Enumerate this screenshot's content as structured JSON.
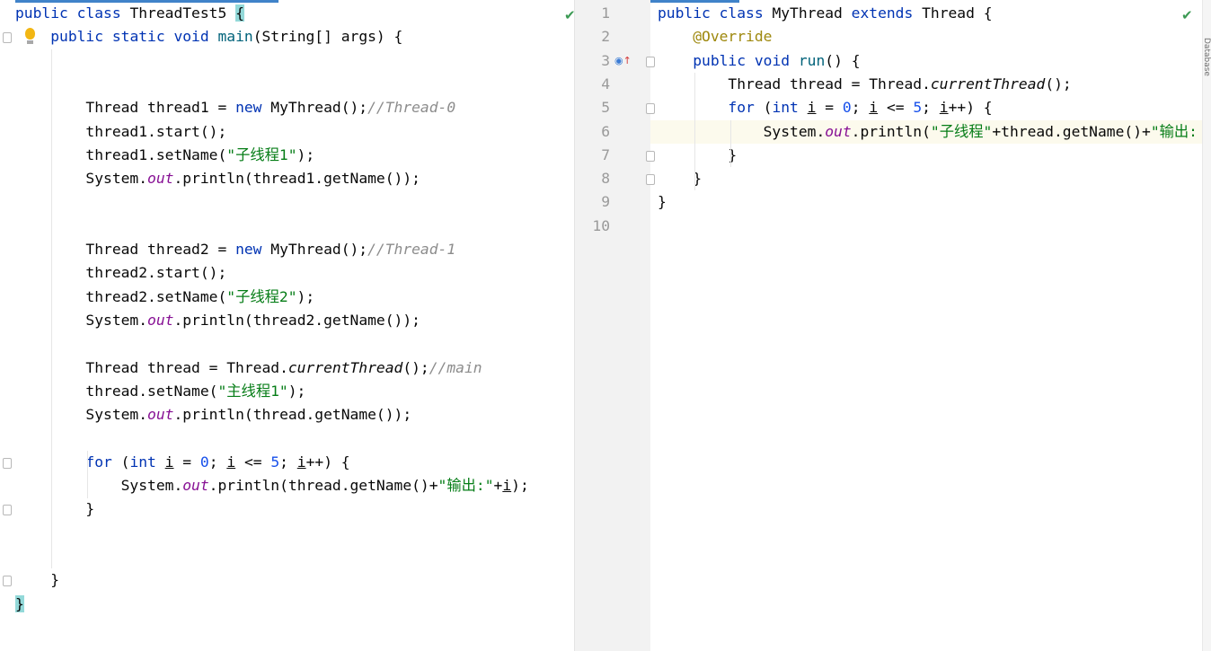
{
  "left_editor": {
    "file": "ThreadTest5",
    "lines": [
      {
        "parts": [
          {
            "t": "public class ",
            "c": "kw"
          },
          {
            "t": "ThreadTest5 "
          },
          {
            "t": "{",
            "c": "brace-hl"
          }
        ]
      },
      {
        "parts": [
          {
            "t": "    "
          },
          {
            "t": "public static void ",
            "c": "kw"
          },
          {
            "t": "main",
            "c": "fn"
          },
          {
            "t": "(String[] args) {"
          }
        ]
      },
      {
        "parts": []
      },
      {
        "parts": []
      },
      {
        "parts": [
          {
            "t": "        Thread thread1 = "
          },
          {
            "t": "new ",
            "c": "kw"
          },
          {
            "t": "MyThread();"
          },
          {
            "t": "//Thread-0",
            "c": "cm"
          }
        ]
      },
      {
        "parts": [
          {
            "t": "        thread1.start();"
          }
        ]
      },
      {
        "parts": [
          {
            "t": "        thread1.setName("
          },
          {
            "t": "\"子线程1\"",
            "c": "str"
          },
          {
            "t": ");"
          }
        ]
      },
      {
        "parts": [
          {
            "t": "        System."
          },
          {
            "t": "out",
            "c": "fld"
          },
          {
            "t": ".println(thread1.getName());"
          }
        ]
      },
      {
        "parts": []
      },
      {
        "parts": []
      },
      {
        "parts": [
          {
            "t": "        Thread thread2 = "
          },
          {
            "t": "new ",
            "c": "kw"
          },
          {
            "t": "MyThread();"
          },
          {
            "t": "//Thread-1",
            "c": "cm"
          }
        ]
      },
      {
        "parts": [
          {
            "t": "        thread2.start();"
          }
        ]
      },
      {
        "parts": [
          {
            "t": "        thread2.setName("
          },
          {
            "t": "\"子线程2\"",
            "c": "str"
          },
          {
            "t": ");"
          }
        ]
      },
      {
        "parts": [
          {
            "t": "        System."
          },
          {
            "t": "out",
            "c": "fld"
          },
          {
            "t": ".println(thread2.getName());"
          }
        ]
      },
      {
        "parts": []
      },
      {
        "parts": [
          {
            "t": "        Thread thread = Thread."
          },
          {
            "t": "currentThread",
            "c": "st"
          },
          {
            "t": "();"
          },
          {
            "t": "//main",
            "c": "cm"
          }
        ]
      },
      {
        "parts": [
          {
            "t": "        thread.setName("
          },
          {
            "t": "\"主线程1\"",
            "c": "str"
          },
          {
            "t": ");"
          }
        ]
      },
      {
        "parts": [
          {
            "t": "        System."
          },
          {
            "t": "out",
            "c": "fld"
          },
          {
            "t": ".println(thread.getName());"
          }
        ]
      },
      {
        "parts": []
      },
      {
        "parts": [
          {
            "t": "        "
          },
          {
            "t": "for ",
            "c": "kw"
          },
          {
            "t": "("
          },
          {
            "t": "int ",
            "c": "kw"
          },
          {
            "t": "i",
            "c": "ul"
          },
          {
            "t": " = "
          },
          {
            "t": "0",
            "c": "num"
          },
          {
            "t": "; "
          },
          {
            "t": "i",
            "c": "ul"
          },
          {
            "t": " <= "
          },
          {
            "t": "5",
            "c": "num"
          },
          {
            "t": "; "
          },
          {
            "t": "i",
            "c": "ul"
          },
          {
            "t": "++) {"
          }
        ]
      },
      {
        "parts": [
          {
            "t": "            System."
          },
          {
            "t": "out",
            "c": "fld"
          },
          {
            "t": ".println(thread.getName()+"
          },
          {
            "t": "\"输出:\"",
            "c": "str"
          },
          {
            "t": "+"
          },
          {
            "t": "i",
            "c": "ul"
          },
          {
            "t": ");"
          }
        ]
      },
      {
        "parts": [
          {
            "t": "        }"
          }
        ]
      },
      {
        "parts": []
      },
      {
        "parts": []
      },
      {
        "parts": [
          {
            "t": "    }"
          }
        ]
      },
      {
        "parts": [
          {
            "t": "}",
            "c": "brace-hl"
          }
        ]
      }
    ]
  },
  "right_editor": {
    "file": "MyThread",
    "line_numbers": [
      "1",
      "2",
      "3",
      "4",
      "5",
      "6",
      "7",
      "8",
      "9",
      "10"
    ],
    "lines": [
      {
        "parts": [
          {
            "t": "public class ",
            "c": "kw"
          },
          {
            "t": "MyThread "
          },
          {
            "t": "extends ",
            "c": "kw"
          },
          {
            "t": "Thread {"
          }
        ]
      },
      {
        "parts": [
          {
            "t": "    "
          },
          {
            "t": "@Override",
            "c": "ann"
          }
        ]
      },
      {
        "parts": [
          {
            "t": "    "
          },
          {
            "t": "public void ",
            "c": "kw"
          },
          {
            "t": "run",
            "c": "fn"
          },
          {
            "t": "() {"
          }
        ]
      },
      {
        "parts": [
          {
            "t": "        Thread thread = Thread."
          },
          {
            "t": "currentThread",
            "c": "st"
          },
          {
            "t": "();"
          }
        ]
      },
      {
        "parts": [
          {
            "t": "        "
          },
          {
            "t": "for ",
            "c": "kw"
          },
          {
            "t": "("
          },
          {
            "t": "int ",
            "c": "kw"
          },
          {
            "t": "i",
            "c": "ul"
          },
          {
            "t": " = "
          },
          {
            "t": "0",
            "c": "num"
          },
          {
            "t": "; "
          },
          {
            "t": "i",
            "c": "ul"
          },
          {
            "t": " <= "
          },
          {
            "t": "5",
            "c": "num"
          },
          {
            "t": "; "
          },
          {
            "t": "i",
            "c": "ul"
          },
          {
            "t": "++) {"
          }
        ]
      },
      {
        "parts": [
          {
            "t": "            System."
          },
          {
            "t": "out",
            "c": "fld"
          },
          {
            "t": ".println("
          },
          {
            "t": "\"子线程\"",
            "c": "str"
          },
          {
            "t": "+thread.getName()+"
          },
          {
            "t": "\"输出:",
            "c": "str"
          }
        ]
      },
      {
        "parts": [
          {
            "t": "        }"
          }
        ]
      },
      {
        "parts": [
          {
            "t": "    }"
          }
        ]
      },
      {
        "parts": [
          {
            "t": "}"
          }
        ]
      },
      {
        "parts": []
      }
    ]
  },
  "icons": {
    "left_status": "check-icon",
    "right_status": "check-icon",
    "intention": "lightbulb-icon",
    "override_marker": "override-gutter-icon"
  },
  "side_panel_label": "Database"
}
